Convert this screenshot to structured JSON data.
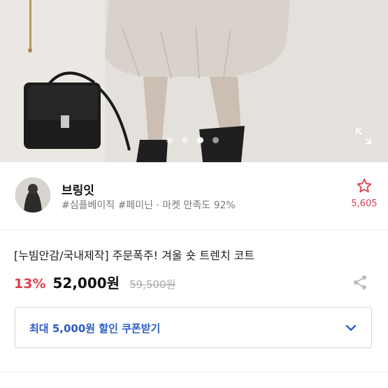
{
  "gallery": {
    "slides_total": 4,
    "active_slide": 3
  },
  "shop": {
    "name": "브링잇",
    "tags": "#심플베이직 #페미닌 · 마켓 만족도 92%",
    "favorite_count": "5,605"
  },
  "product": {
    "title": "[누빔안감/국내제작] 주문폭주! 겨울 숏 트렌치 코트",
    "discount": "13%",
    "price": "52,000원",
    "original_price": "59,500원"
  },
  "coupon": {
    "label": "최대 5,000원 할인 쿠폰받기"
  },
  "colors": {
    "accent_red": "#e0404c",
    "coupon_blue": "#2c5cc5"
  },
  "icons": [
    "expand-icon",
    "star-icon",
    "share-icon",
    "chevron-down-icon"
  ]
}
